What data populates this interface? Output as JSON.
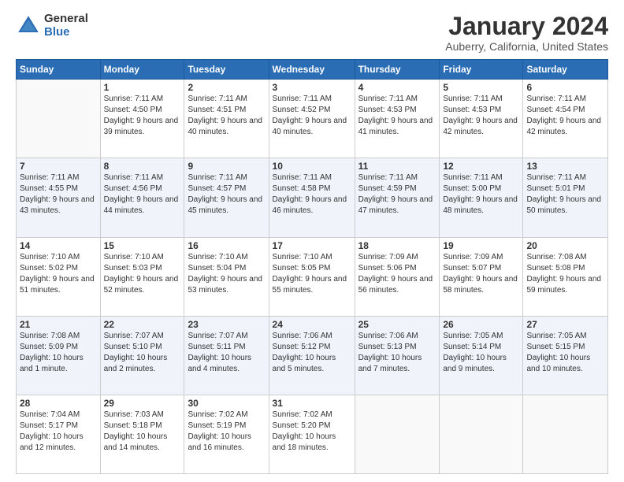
{
  "logo": {
    "general": "General",
    "blue": "Blue"
  },
  "title": {
    "month": "January 2024",
    "location": "Auberry, California, United States"
  },
  "weekdays": [
    "Sunday",
    "Monday",
    "Tuesday",
    "Wednesday",
    "Thursday",
    "Friday",
    "Saturday"
  ],
  "weeks": [
    [
      {
        "day": "",
        "sunrise": "",
        "sunset": "",
        "daylight": ""
      },
      {
        "day": "1",
        "sunrise": "Sunrise: 7:11 AM",
        "sunset": "Sunset: 4:50 PM",
        "daylight": "Daylight: 9 hours and 39 minutes."
      },
      {
        "day": "2",
        "sunrise": "Sunrise: 7:11 AM",
        "sunset": "Sunset: 4:51 PM",
        "daylight": "Daylight: 9 hours and 40 minutes."
      },
      {
        "day": "3",
        "sunrise": "Sunrise: 7:11 AM",
        "sunset": "Sunset: 4:52 PM",
        "daylight": "Daylight: 9 hours and 40 minutes."
      },
      {
        "day": "4",
        "sunrise": "Sunrise: 7:11 AM",
        "sunset": "Sunset: 4:53 PM",
        "daylight": "Daylight: 9 hours and 41 minutes."
      },
      {
        "day": "5",
        "sunrise": "Sunrise: 7:11 AM",
        "sunset": "Sunset: 4:53 PM",
        "daylight": "Daylight: 9 hours and 42 minutes."
      },
      {
        "day": "6",
        "sunrise": "Sunrise: 7:11 AM",
        "sunset": "Sunset: 4:54 PM",
        "daylight": "Daylight: 9 hours and 42 minutes."
      }
    ],
    [
      {
        "day": "7",
        "sunrise": "Sunrise: 7:11 AM",
        "sunset": "Sunset: 4:55 PM",
        "daylight": "Daylight: 9 hours and 43 minutes."
      },
      {
        "day": "8",
        "sunrise": "Sunrise: 7:11 AM",
        "sunset": "Sunset: 4:56 PM",
        "daylight": "Daylight: 9 hours and 44 minutes."
      },
      {
        "day": "9",
        "sunrise": "Sunrise: 7:11 AM",
        "sunset": "Sunset: 4:57 PM",
        "daylight": "Daylight: 9 hours and 45 minutes."
      },
      {
        "day": "10",
        "sunrise": "Sunrise: 7:11 AM",
        "sunset": "Sunset: 4:58 PM",
        "daylight": "Daylight: 9 hours and 46 minutes."
      },
      {
        "day": "11",
        "sunrise": "Sunrise: 7:11 AM",
        "sunset": "Sunset: 4:59 PM",
        "daylight": "Daylight: 9 hours and 47 minutes."
      },
      {
        "day": "12",
        "sunrise": "Sunrise: 7:11 AM",
        "sunset": "Sunset: 5:00 PM",
        "daylight": "Daylight: 9 hours and 48 minutes."
      },
      {
        "day": "13",
        "sunrise": "Sunrise: 7:11 AM",
        "sunset": "Sunset: 5:01 PM",
        "daylight": "Daylight: 9 hours and 50 minutes."
      }
    ],
    [
      {
        "day": "14",
        "sunrise": "Sunrise: 7:10 AM",
        "sunset": "Sunset: 5:02 PM",
        "daylight": "Daylight: 9 hours and 51 minutes."
      },
      {
        "day": "15",
        "sunrise": "Sunrise: 7:10 AM",
        "sunset": "Sunset: 5:03 PM",
        "daylight": "Daylight: 9 hours and 52 minutes."
      },
      {
        "day": "16",
        "sunrise": "Sunrise: 7:10 AM",
        "sunset": "Sunset: 5:04 PM",
        "daylight": "Daylight: 9 hours and 53 minutes."
      },
      {
        "day": "17",
        "sunrise": "Sunrise: 7:10 AM",
        "sunset": "Sunset: 5:05 PM",
        "daylight": "Daylight: 9 hours and 55 minutes."
      },
      {
        "day": "18",
        "sunrise": "Sunrise: 7:09 AM",
        "sunset": "Sunset: 5:06 PM",
        "daylight": "Daylight: 9 hours and 56 minutes."
      },
      {
        "day": "19",
        "sunrise": "Sunrise: 7:09 AM",
        "sunset": "Sunset: 5:07 PM",
        "daylight": "Daylight: 9 hours and 58 minutes."
      },
      {
        "day": "20",
        "sunrise": "Sunrise: 7:08 AM",
        "sunset": "Sunset: 5:08 PM",
        "daylight": "Daylight: 9 hours and 59 minutes."
      }
    ],
    [
      {
        "day": "21",
        "sunrise": "Sunrise: 7:08 AM",
        "sunset": "Sunset: 5:09 PM",
        "daylight": "Daylight: 10 hours and 1 minute."
      },
      {
        "day": "22",
        "sunrise": "Sunrise: 7:07 AM",
        "sunset": "Sunset: 5:10 PM",
        "daylight": "Daylight: 10 hours and 2 minutes."
      },
      {
        "day": "23",
        "sunrise": "Sunrise: 7:07 AM",
        "sunset": "Sunset: 5:11 PM",
        "daylight": "Daylight: 10 hours and 4 minutes."
      },
      {
        "day": "24",
        "sunrise": "Sunrise: 7:06 AM",
        "sunset": "Sunset: 5:12 PM",
        "daylight": "Daylight: 10 hours and 5 minutes."
      },
      {
        "day": "25",
        "sunrise": "Sunrise: 7:06 AM",
        "sunset": "Sunset: 5:13 PM",
        "daylight": "Daylight: 10 hours and 7 minutes."
      },
      {
        "day": "26",
        "sunrise": "Sunrise: 7:05 AM",
        "sunset": "Sunset: 5:14 PM",
        "daylight": "Daylight: 10 hours and 9 minutes."
      },
      {
        "day": "27",
        "sunrise": "Sunrise: 7:05 AM",
        "sunset": "Sunset: 5:15 PM",
        "daylight": "Daylight: 10 hours and 10 minutes."
      }
    ],
    [
      {
        "day": "28",
        "sunrise": "Sunrise: 7:04 AM",
        "sunset": "Sunset: 5:17 PM",
        "daylight": "Daylight: 10 hours and 12 minutes."
      },
      {
        "day": "29",
        "sunrise": "Sunrise: 7:03 AM",
        "sunset": "Sunset: 5:18 PM",
        "daylight": "Daylight: 10 hours and 14 minutes."
      },
      {
        "day": "30",
        "sunrise": "Sunrise: 7:02 AM",
        "sunset": "Sunset: 5:19 PM",
        "daylight": "Daylight: 10 hours and 16 minutes."
      },
      {
        "day": "31",
        "sunrise": "Sunrise: 7:02 AM",
        "sunset": "Sunset: 5:20 PM",
        "daylight": "Daylight: 10 hours and 18 minutes."
      },
      {
        "day": "",
        "sunrise": "",
        "sunset": "",
        "daylight": ""
      },
      {
        "day": "",
        "sunrise": "",
        "sunset": "",
        "daylight": ""
      },
      {
        "day": "",
        "sunrise": "",
        "sunset": "",
        "daylight": ""
      }
    ]
  ]
}
